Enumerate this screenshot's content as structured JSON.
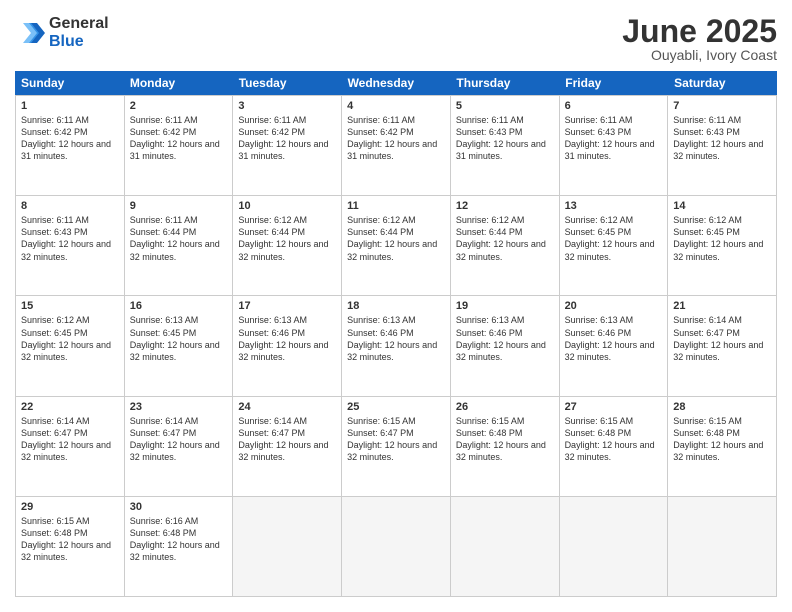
{
  "logo": {
    "general": "General",
    "blue": "Blue"
  },
  "title": "June 2025",
  "location": "Ouyabli, Ivory Coast",
  "header_days": [
    "Sunday",
    "Monday",
    "Tuesday",
    "Wednesday",
    "Thursday",
    "Friday",
    "Saturday"
  ],
  "weeks": [
    [
      {
        "day": 1,
        "rise": "6:11 AM",
        "set": "6:42 PM",
        "daylight": "12 hours and 31 minutes."
      },
      {
        "day": 2,
        "rise": "6:11 AM",
        "set": "6:42 PM",
        "daylight": "12 hours and 31 minutes."
      },
      {
        "day": 3,
        "rise": "6:11 AM",
        "set": "6:42 PM",
        "daylight": "12 hours and 31 minutes."
      },
      {
        "day": 4,
        "rise": "6:11 AM",
        "set": "6:42 PM",
        "daylight": "12 hours and 31 minutes."
      },
      {
        "day": 5,
        "rise": "6:11 AM",
        "set": "6:43 PM",
        "daylight": "12 hours and 31 minutes."
      },
      {
        "day": 6,
        "rise": "6:11 AM",
        "set": "6:43 PM",
        "daylight": "12 hours and 31 minutes."
      },
      {
        "day": 7,
        "rise": "6:11 AM",
        "set": "6:43 PM",
        "daylight": "12 hours and 32 minutes."
      }
    ],
    [
      {
        "day": 8,
        "rise": "6:11 AM",
        "set": "6:43 PM",
        "daylight": "12 hours and 32 minutes."
      },
      {
        "day": 9,
        "rise": "6:11 AM",
        "set": "6:44 PM",
        "daylight": "12 hours and 32 minutes."
      },
      {
        "day": 10,
        "rise": "6:12 AM",
        "set": "6:44 PM",
        "daylight": "12 hours and 32 minutes."
      },
      {
        "day": 11,
        "rise": "6:12 AM",
        "set": "6:44 PM",
        "daylight": "12 hours and 32 minutes."
      },
      {
        "day": 12,
        "rise": "6:12 AM",
        "set": "6:44 PM",
        "daylight": "12 hours and 32 minutes."
      },
      {
        "day": 13,
        "rise": "6:12 AM",
        "set": "6:45 PM",
        "daylight": "12 hours and 32 minutes."
      },
      {
        "day": 14,
        "rise": "6:12 AM",
        "set": "6:45 PM",
        "daylight": "12 hours and 32 minutes."
      }
    ],
    [
      {
        "day": 15,
        "rise": "6:12 AM",
        "set": "6:45 PM",
        "daylight": "12 hours and 32 minutes."
      },
      {
        "day": 16,
        "rise": "6:13 AM",
        "set": "6:45 PM",
        "daylight": "12 hours and 32 minutes."
      },
      {
        "day": 17,
        "rise": "6:13 AM",
        "set": "6:46 PM",
        "daylight": "12 hours and 32 minutes."
      },
      {
        "day": 18,
        "rise": "6:13 AM",
        "set": "6:46 PM",
        "daylight": "12 hours and 32 minutes."
      },
      {
        "day": 19,
        "rise": "6:13 AM",
        "set": "6:46 PM",
        "daylight": "12 hours and 32 minutes."
      },
      {
        "day": 20,
        "rise": "6:13 AM",
        "set": "6:46 PM",
        "daylight": "12 hours and 32 minutes."
      },
      {
        "day": 21,
        "rise": "6:14 AM",
        "set": "6:47 PM",
        "daylight": "12 hours and 32 minutes."
      }
    ],
    [
      {
        "day": 22,
        "rise": "6:14 AM",
        "set": "6:47 PM",
        "daylight": "12 hours and 32 minutes."
      },
      {
        "day": 23,
        "rise": "6:14 AM",
        "set": "6:47 PM",
        "daylight": "12 hours and 32 minutes."
      },
      {
        "day": 24,
        "rise": "6:14 AM",
        "set": "6:47 PM",
        "daylight": "12 hours and 32 minutes."
      },
      {
        "day": 25,
        "rise": "6:15 AM",
        "set": "6:47 PM",
        "daylight": "12 hours and 32 minutes."
      },
      {
        "day": 26,
        "rise": "6:15 AM",
        "set": "6:48 PM",
        "daylight": "12 hours and 32 minutes."
      },
      {
        "day": 27,
        "rise": "6:15 AM",
        "set": "6:48 PM",
        "daylight": "12 hours and 32 minutes."
      },
      {
        "day": 28,
        "rise": "6:15 AM",
        "set": "6:48 PM",
        "daylight": "12 hours and 32 minutes."
      }
    ],
    [
      {
        "day": 29,
        "rise": "6:15 AM",
        "set": "6:48 PM",
        "daylight": "12 hours and 32 minutes."
      },
      {
        "day": 30,
        "rise": "6:16 AM",
        "set": "6:48 PM",
        "daylight": "12 hours and 32 minutes."
      },
      null,
      null,
      null,
      null,
      null
    ]
  ]
}
